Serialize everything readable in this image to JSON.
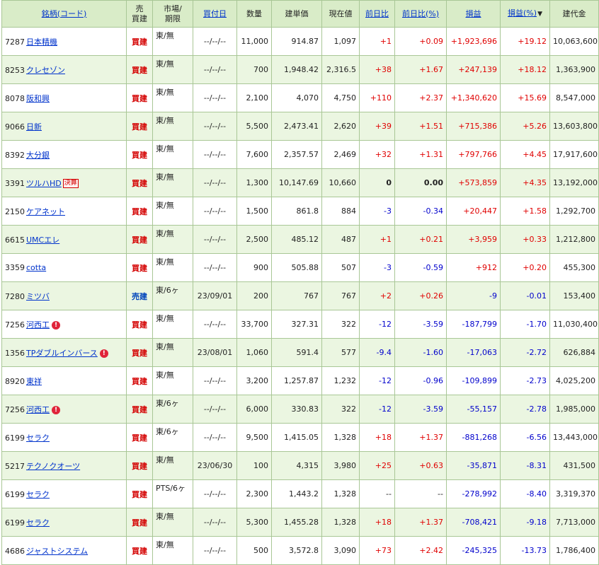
{
  "headers": {
    "name": "銘柄(コード)",
    "side_l1": "売",
    "side_l2": "買建",
    "market_l1": "市場/",
    "market_l2": "期限",
    "date": "買付日",
    "qty": "数量",
    "price": "建単価",
    "current": "現在値",
    "chg": "前日比",
    "chg_pct": "前日比(%)",
    "pl": "損益",
    "pl_pct": "損益(%)",
    "value": "建代金"
  },
  "colors": {
    "header_bg": "#d9ecc8",
    "row_alt": "#ebf6e1",
    "positive": "#e00000",
    "negative": "#0000cc",
    "link": "#0033cc"
  },
  "rows": [
    {
      "code": "7287",
      "name": "日本精機",
      "side": "買建",
      "market": "東/無",
      "date": "--/--/--",
      "qty": "11,000",
      "price": "914.87",
      "current": "1,097",
      "chg": "+1",
      "chg_pct": "+0.09",
      "pl": "+1,923,696",
      "pl_pct": "+19.12",
      "value": "10,063,600"
    },
    {
      "code": "8253",
      "name": "クレセゾン",
      "side": "買建",
      "market": "東/無",
      "date": "--/--/--",
      "qty": "700",
      "price": "1,948.42",
      "current": "2,316.5",
      "chg": "+38",
      "chg_pct": "+1.67",
      "pl": "+247,139",
      "pl_pct": "+18.12",
      "value": "1,363,900"
    },
    {
      "code": "8078",
      "name": "阪和興",
      "side": "買建",
      "market": "東/無",
      "date": "--/--/--",
      "qty": "2,100",
      "price": "4,070",
      "current": "4,750",
      "chg": "+110",
      "chg_pct": "+2.37",
      "pl": "+1,340,620",
      "pl_pct": "+15.69",
      "value": "8,547,000"
    },
    {
      "code": "9066",
      "name": "日新",
      "side": "買建",
      "market": "東/無",
      "date": "--/--/--",
      "qty": "5,500",
      "price": "2,473.41",
      "current": "2,620",
      "chg": "+39",
      "chg_pct": "+1.51",
      "pl": "+715,386",
      "pl_pct": "+5.26",
      "value": "13,603,800"
    },
    {
      "code": "8392",
      "name": "大分銀",
      "side": "買建",
      "market": "東/無",
      "date": "--/--/--",
      "qty": "7,600",
      "price": "2,357.57",
      "current": "2,469",
      "chg": "+32",
      "chg_pct": "+1.31",
      "pl": "+797,766",
      "pl_pct": "+4.45",
      "value": "17,917,600"
    },
    {
      "code": "3391",
      "name": "ツルハHD",
      "badge": "決算",
      "side": "買建",
      "market": "東/無",
      "date": "--/--/--",
      "qty": "1,300",
      "price": "10,147.69",
      "current": "10,660",
      "chg": "0",
      "chg_pct": "0.00",
      "pl": "+573,859",
      "pl_pct": "+4.35",
      "value": "13,192,000"
    },
    {
      "code": "2150",
      "name": "ケアネット",
      "side": "買建",
      "market": "東/無",
      "date": "--/--/--",
      "qty": "1,500",
      "price": "861.8",
      "current": "884",
      "chg": "-3",
      "chg_pct": "-0.34",
      "pl": "+20,447",
      "pl_pct": "+1.58",
      "value": "1,292,700"
    },
    {
      "code": "6615",
      "name": "UMCエレ",
      "side": "買建",
      "market": "東/無",
      "date": "--/--/--",
      "qty": "2,500",
      "price": "485.12",
      "current": "487",
      "chg": "+1",
      "chg_pct": "+0.21",
      "pl": "+3,959",
      "pl_pct": "+0.33",
      "value": "1,212,800"
    },
    {
      "code": "3359",
      "name": "cotta",
      "side": "買建",
      "market": "東/無",
      "date": "--/--/--",
      "qty": "900",
      "price": "505.88",
      "current": "507",
      "chg": "-3",
      "chg_pct": "-0.59",
      "pl": "+912",
      "pl_pct": "+0.20",
      "value": "455,300"
    },
    {
      "code": "7280",
      "name": "ミツバ",
      "side": "売建",
      "market": "東/6ヶ",
      "date": "23/09/01",
      "qty": "200",
      "price": "767",
      "current": "767",
      "chg": "+2",
      "chg_pct": "+0.26",
      "pl": "-9",
      "pl_pct": "-0.01",
      "value": "153,400"
    },
    {
      "code": "7256",
      "name": "河西工",
      "alert": "!",
      "side": "買建",
      "market": "東/無",
      "date": "--/--/--",
      "qty": "33,700",
      "price": "327.31",
      "current": "322",
      "chg": "-12",
      "chg_pct": "-3.59",
      "pl": "-187,799",
      "pl_pct": "-1.70",
      "value": "11,030,400"
    },
    {
      "code": "1356",
      "name": "TPダブルインバース",
      "alert": "!",
      "side": "買建",
      "market": "東/無",
      "date": "23/08/01",
      "qty": "1,060",
      "price": "591.4",
      "current": "577",
      "chg": "-9.4",
      "chg_pct": "-1.60",
      "pl": "-17,063",
      "pl_pct": "-2.72",
      "value": "626,884"
    },
    {
      "code": "8920",
      "name": "東祥",
      "side": "買建",
      "market": "東/無",
      "date": "--/--/--",
      "qty": "3,200",
      "price": "1,257.87",
      "current": "1,232",
      "chg": "-12",
      "chg_pct": "-0.96",
      "pl": "-109,899",
      "pl_pct": "-2.73",
      "value": "4,025,200"
    },
    {
      "code": "7256",
      "name": "河西工",
      "alert": "!",
      "side": "買建",
      "market": "東/6ヶ",
      "date": "--/--/--",
      "qty": "6,000",
      "price": "330.83",
      "current": "322",
      "chg": "-12",
      "chg_pct": "-3.59",
      "pl": "-55,157",
      "pl_pct": "-2.78",
      "value": "1,985,000"
    },
    {
      "code": "6199",
      "name": "セラク",
      "side": "買建",
      "market": "東/6ヶ",
      "date": "--/--/--",
      "qty": "9,500",
      "price": "1,415.05",
      "current": "1,328",
      "chg": "+18",
      "chg_pct": "+1.37",
      "pl": "-881,268",
      "pl_pct": "-6.56",
      "value": "13,443,000"
    },
    {
      "code": "5217",
      "name": "テクノクオーツ",
      "side": "買建",
      "market": "東/無",
      "date": "23/06/30",
      "qty": "100",
      "price": "4,315",
      "current": "3,980",
      "chg": "+25",
      "chg_pct": "+0.63",
      "pl": "-35,871",
      "pl_pct": "-8.31",
      "value": "431,500"
    },
    {
      "code": "6199",
      "name": "セラク",
      "side": "買建",
      "market": "PTS/6ヶ",
      "date": "--/--/--",
      "qty": "2,300",
      "price": "1,443.2",
      "current": "1,328",
      "chg": "--",
      "chg_pct": "--",
      "pl": "-278,992",
      "pl_pct": "-8.40",
      "value": "3,319,370"
    },
    {
      "code": "6199",
      "name": "セラク",
      "side": "買建",
      "market": "東/無",
      "date": "--/--/--",
      "qty": "5,300",
      "price": "1,455.28",
      "current": "1,328",
      "chg": "+18",
      "chg_pct": "+1.37",
      "pl": "-708,421",
      "pl_pct": "-9.18",
      "value": "7,713,000"
    },
    {
      "code": "4686",
      "name": "ジャストシステム",
      "side": "買建",
      "market": "東/無",
      "date": "--/--/--",
      "qty": "500",
      "price": "3,572.8",
      "current": "3,090",
      "chg": "+73",
      "chg_pct": "+2.42",
      "pl": "-245,325",
      "pl_pct": "-13.73",
      "value": "1,786,400"
    }
  ]
}
